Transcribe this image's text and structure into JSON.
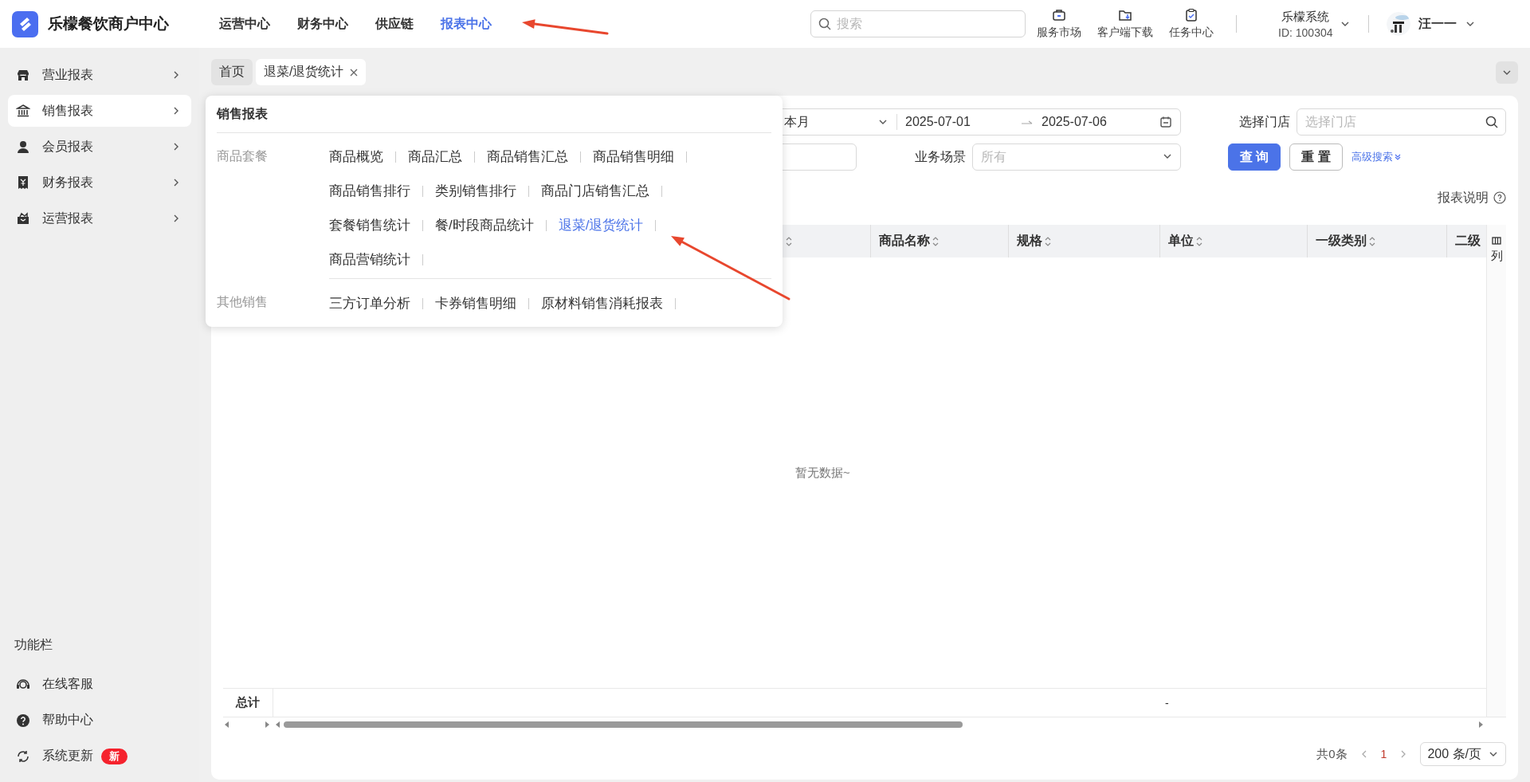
{
  "app": {
    "title": "乐檬餐饮商户中心"
  },
  "top_nav": [
    {
      "label": "运营中心",
      "selected": false
    },
    {
      "label": "财务中心",
      "selected": false
    },
    {
      "label": "供应链",
      "selected": false
    },
    {
      "label": "报表中心",
      "selected": true
    }
  ],
  "search": {
    "placeholder": "搜索"
  },
  "toolbar": [
    {
      "label": "服务市场",
      "kind": "briefcase"
    },
    {
      "label": "客户端下载",
      "kind": "download"
    },
    {
      "label": "任务中心",
      "kind": "clipboard"
    }
  ],
  "account": {
    "name": "乐檬系统",
    "id": "ID: 100304"
  },
  "user": {
    "name": "汪一一"
  },
  "sidebar": {
    "items": [
      {
        "label": "营业报表",
        "kind": "store",
        "selected": false
      },
      {
        "label": "销售报表",
        "kind": "bank",
        "selected": true
      },
      {
        "label": "会员报表",
        "kind": "person",
        "selected": false
      },
      {
        "label": "财务报表",
        "kind": "receipt",
        "selected": false
      },
      {
        "label": "运营报表",
        "kind": "box",
        "selected": false
      }
    ],
    "footer_title": "功能栏",
    "footer_items": [
      {
        "label": "在线客服",
        "kind": "headset"
      },
      {
        "label": "帮助中心",
        "kind": "help"
      },
      {
        "label": "系统更新",
        "kind": "refresh",
        "badge": "新"
      }
    ]
  },
  "tabs": [
    {
      "label": "首页",
      "selected": false,
      "closable": false
    },
    {
      "label": "退菜/退货统计",
      "selected": true,
      "closable": true
    }
  ],
  "filters": {
    "range_type": "本月",
    "date_start": "2025-07-01",
    "date_end": "2025-07-06",
    "store_label": "选择门店",
    "store_placeholder": "选择门店",
    "scene_label": "业务场景",
    "scene_placeholder": "所有",
    "query_button": "查 询",
    "reset_button": "重 置",
    "advanced_link": "高级搜索"
  },
  "report_help": "报表说明",
  "table": {
    "columns": [
      {
        "label": "商品名称"
      },
      {
        "label": "规格"
      },
      {
        "label": "单位"
      },
      {
        "label": "一级类别"
      },
      {
        "label": "二级"
      }
    ],
    "column_settings": "列",
    "empty_text": "暂无数据~",
    "summary": {
      "label": "总计",
      "value": "-"
    }
  },
  "pagination": {
    "total": "共0条",
    "pages": [
      {
        "label": "1",
        "selected": true
      }
    ],
    "page_size": "200 条/页"
  },
  "dropdown_menu": {
    "title": "销售报表",
    "groups": [
      {
        "label": "商品套餐",
        "rows": [
          [
            {
              "label": "商品概览",
              "selected": false
            },
            {
              "label": "商品汇总",
              "selected": false
            },
            {
              "label": "商品销售汇总",
              "selected": false
            },
            {
              "label": "商品销售明细",
              "selected": false
            }
          ],
          [
            {
              "label": "商品销售排行",
              "selected": false
            },
            {
              "label": "类别销售排行",
              "selected": false
            },
            {
              "label": "商品门店销售汇总",
              "selected": false
            }
          ],
          [
            {
              "label": "套餐销售统计",
              "selected": false
            },
            {
              "label": "餐/时段商品统计",
              "selected": false
            },
            {
              "label": "退菜/退货统计",
              "selected": true
            }
          ],
          [
            {
              "label": "商品营销统计",
              "selected": false
            }
          ]
        ]
      },
      {
        "label": "其他销售",
        "rows": [
          [
            {
              "label": "三方订单分析",
              "selected": false
            },
            {
              "label": "卡券销售明细",
              "selected": false
            },
            {
              "label": "原材料销售消耗报表",
              "selected": false
            }
          ]
        ]
      }
    ]
  },
  "annotations": [
    {
      "kind": "arrow"
    },
    {
      "kind": "arrow"
    }
  ]
}
